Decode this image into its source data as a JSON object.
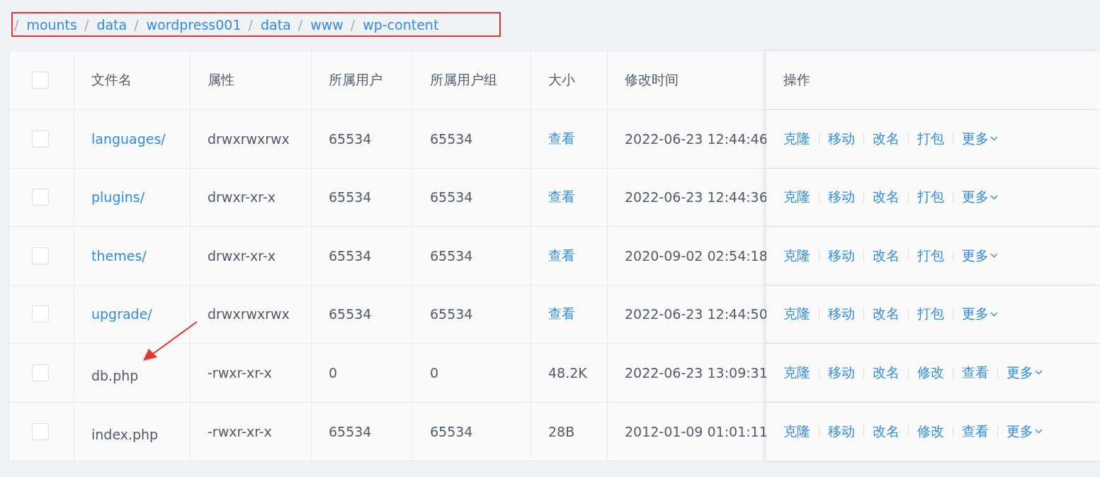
{
  "breadcrumb": {
    "separator": "/",
    "items": [
      "mounts",
      "data",
      "wordpress001",
      "data",
      "www",
      "wp-content"
    ],
    "highlighted": true
  },
  "table": {
    "header_checked": false,
    "columns": [
      "文件名",
      "属性",
      "所属用户",
      "所属用户组",
      "大小",
      "修改时间",
      "操作"
    ],
    "rows": [
      {
        "kind": "dir",
        "checked": false,
        "name": "languages/",
        "perms": "drwxrwxrwx",
        "owner": "65534",
        "group": "65534",
        "size": "查看",
        "size_is_link": true,
        "mtime": "2022-06-23 12:44:46",
        "actions": [
          "克隆",
          "移动",
          "改名",
          "打包"
        ],
        "more": "更多",
        "pointed": false
      },
      {
        "kind": "dir",
        "checked": false,
        "name": "plugins/",
        "perms": "drwxr-xr-x",
        "owner": "65534",
        "group": "65534",
        "size": "查看",
        "size_is_link": true,
        "mtime": "2022-06-23 12:44:36",
        "actions": [
          "克隆",
          "移动",
          "改名",
          "打包"
        ],
        "more": "更多",
        "pointed": false
      },
      {
        "kind": "dir",
        "checked": false,
        "name": "themes/",
        "perms": "drwxr-xr-x",
        "owner": "65534",
        "group": "65534",
        "size": "查看",
        "size_is_link": true,
        "mtime": "2020-09-02 02:54:18",
        "actions": [
          "克隆",
          "移动",
          "改名",
          "打包"
        ],
        "more": "更多",
        "pointed": false
      },
      {
        "kind": "dir",
        "checked": false,
        "name": "upgrade/",
        "perms": "drwxrwxrwx",
        "owner": "65534",
        "group": "65534",
        "size": "查看",
        "size_is_link": true,
        "mtime": "2022-06-23 12:44:50",
        "actions": [
          "克隆",
          "移动",
          "改名",
          "打包"
        ],
        "more": "更多",
        "pointed": false
      },
      {
        "kind": "file",
        "checked": false,
        "name": "db.php",
        "perms": "-rwxr-xr-x",
        "owner": "0",
        "group": "0",
        "size": "48.2K",
        "size_is_link": false,
        "mtime": "2022-06-23 13:09:31",
        "actions": [
          "克隆",
          "移动",
          "改名",
          "修改",
          "查看"
        ],
        "more": "更多",
        "pointed": true
      },
      {
        "kind": "file",
        "checked": false,
        "name": "index.php",
        "perms": "-rwxr-xr-x",
        "owner": "65534",
        "group": "65534",
        "size": "28B",
        "size_is_link": false,
        "mtime": "2012-01-09 01:01:11",
        "actions": [
          "克隆",
          "移动",
          "改名",
          "修改",
          "查看"
        ],
        "more": "更多",
        "pointed": false
      }
    ]
  }
}
